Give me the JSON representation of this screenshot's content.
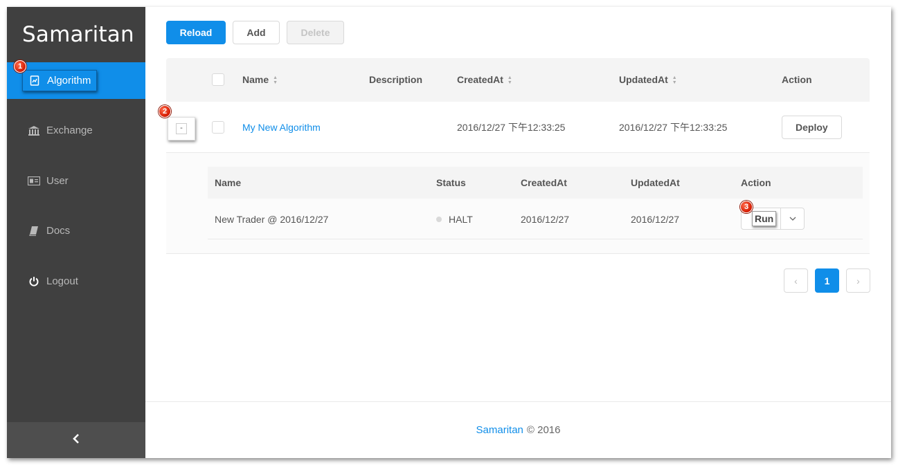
{
  "sidebar": {
    "brand": "Samaritan",
    "items": [
      {
        "label": "Algorithm",
        "icon": "algorithm-icon",
        "active": true
      },
      {
        "label": "Exchange",
        "icon": "bank-icon"
      },
      {
        "label": "User",
        "icon": "id-card-icon"
      },
      {
        "label": "Docs",
        "icon": "book-icon"
      },
      {
        "label": "Logout",
        "icon": "power-icon"
      }
    ],
    "collapse_icon": "chevron-left-icon"
  },
  "badges": {
    "one": "1",
    "two": "2",
    "three": "3"
  },
  "toolbar": {
    "reload": "Reload",
    "add": "Add",
    "delete": "Delete"
  },
  "table": {
    "headers": {
      "name": "Name",
      "description": "Description",
      "created": "CreatedAt",
      "updated": "UpdatedAt",
      "action": "Action"
    },
    "rows": [
      {
        "expand": "-",
        "name": "My New Algorithm",
        "description": "",
        "created": "2016/12/27 下午12:33:25",
        "updated": "2016/12/27 下午12:33:25",
        "action": "Deploy"
      }
    ]
  },
  "subtable": {
    "headers": {
      "name": "Name",
      "status": "Status",
      "created": "CreatedAt",
      "updated": "UpdatedAt",
      "action": "Action"
    },
    "rows": [
      {
        "name": "New Trader @ 2016/12/27",
        "status": "HALT",
        "created": "2016/12/27",
        "updated": "2016/12/27",
        "action": "Run"
      }
    ]
  },
  "pagination": {
    "prev": "‹",
    "current": "1",
    "next": "›"
  },
  "footer": {
    "link": "Samaritan",
    "text": "© 2016"
  },
  "colors": {
    "primary": "#108ee9",
    "sidebar": "#404040"
  }
}
